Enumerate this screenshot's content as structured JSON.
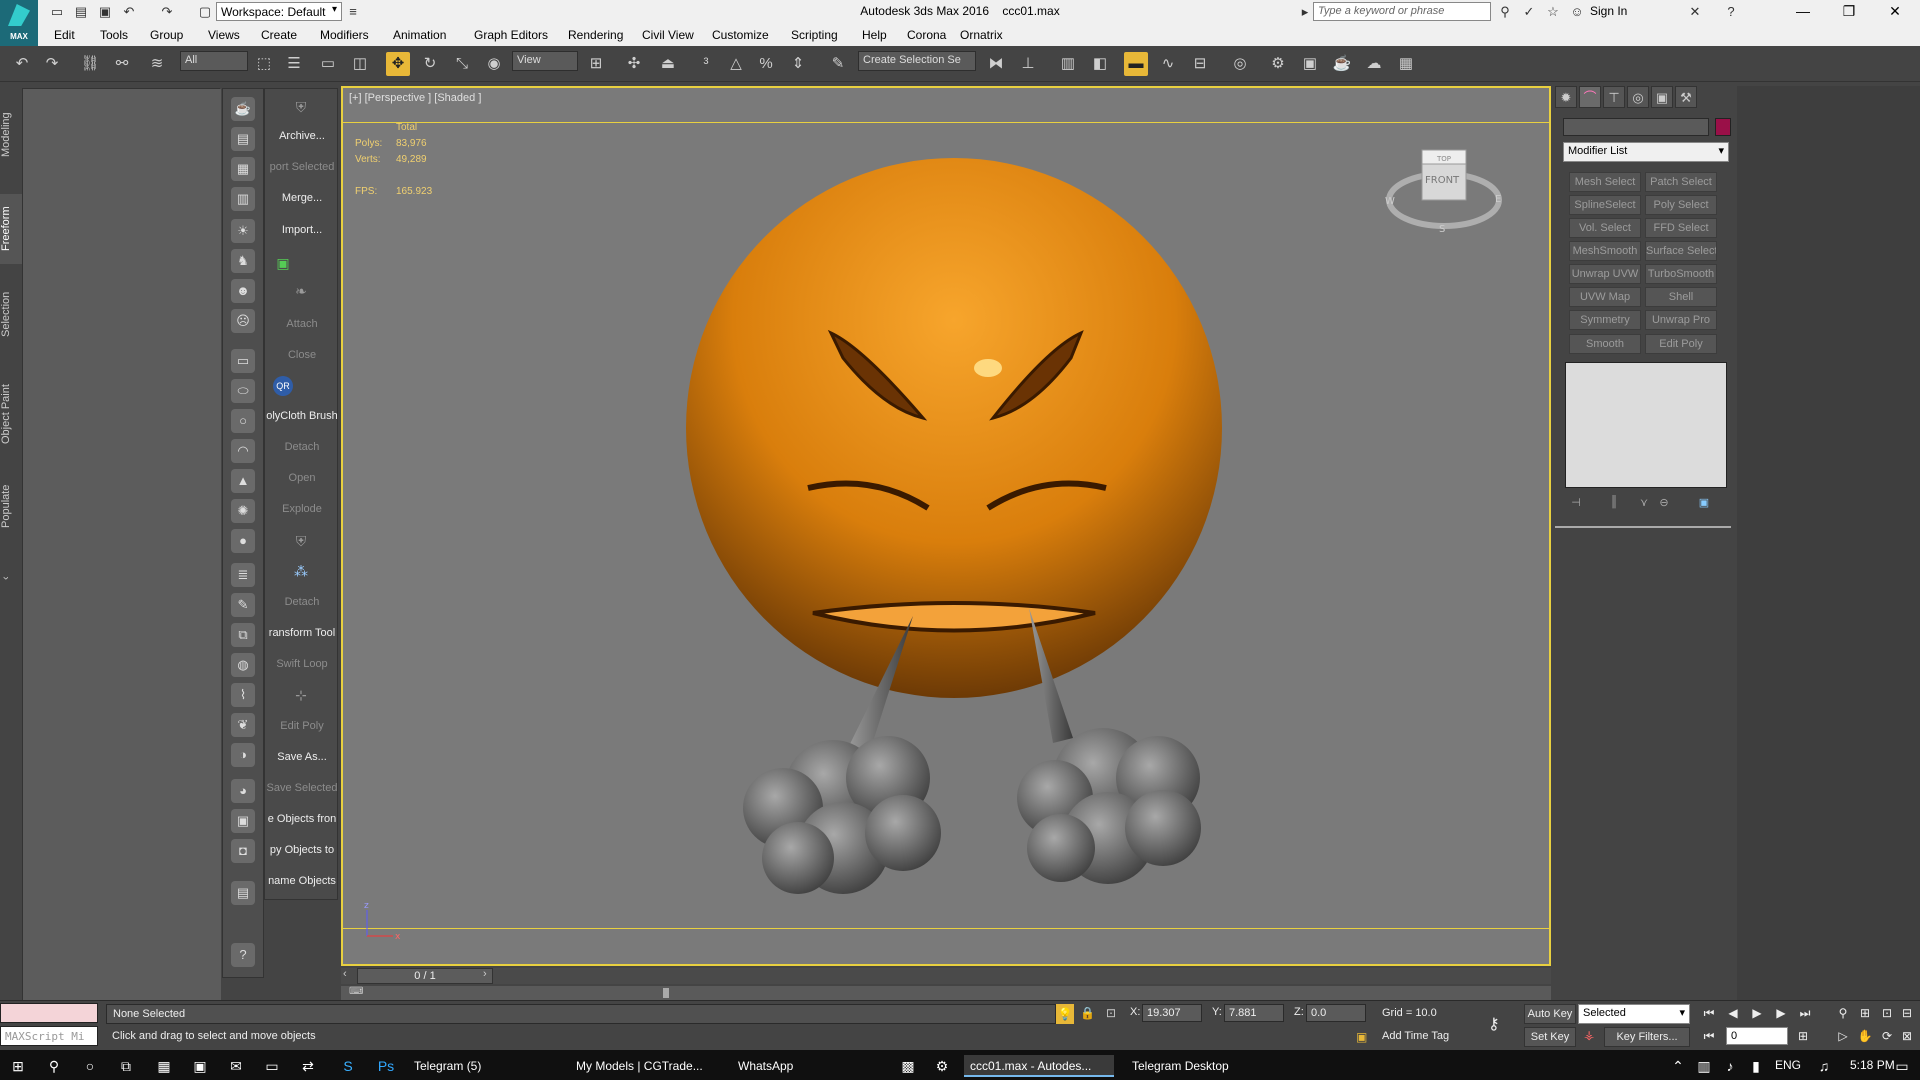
{
  "window": {
    "title": "Autodesk 3ds Max 2016",
    "file": "ccc01.max",
    "logo_text": "MAX"
  },
  "workspace": {
    "label": "Workspace: Default"
  },
  "search": {
    "placeholder": "Type a keyword or phrase"
  },
  "account": {
    "sign_in": "Sign In"
  },
  "menu": [
    "Edit",
    "Tools",
    "Group",
    "Views",
    "Create",
    "Modifiers",
    "Animation",
    "Graph Editors",
    "Rendering",
    "Civil View",
    "Customize",
    "Scripting",
    "Help",
    "Corona",
    "Ornatrix"
  ],
  "toolbar": {
    "filter": "All",
    "ref_coord": "View",
    "named_selection": "Create Selection Se"
  },
  "left_tabs": [
    "Modeling",
    "Freeform",
    "Selection",
    "Object Paint",
    "Populate"
  ],
  "tool_list": [
    {
      "label": "Archive...",
      "enabled": true
    },
    {
      "label": "port Selected",
      "enabled": false
    },
    {
      "label": "Merge...",
      "enabled": true
    },
    {
      "label": "Import...",
      "enabled": true
    },
    {
      "label": "Attach",
      "enabled": false
    },
    {
      "label": "Close",
      "enabled": false
    },
    {
      "label": "QR",
      "enabled": true
    },
    {
      "label": "olyCloth Brush",
      "enabled": true
    },
    {
      "label": "Detach",
      "enabled": false
    },
    {
      "label": "Open",
      "enabled": false
    },
    {
      "label": "Explode",
      "enabled": false
    },
    {
      "label": "Detach",
      "enabled": false
    },
    {
      "label": "ransform Tool",
      "enabled": true
    },
    {
      "label": "Swift Loop",
      "enabled": false
    },
    {
      "label": "Edit Poly",
      "enabled": false
    },
    {
      "label": "Save As...",
      "enabled": true
    },
    {
      "label": "Save Selected",
      "enabled": false
    },
    {
      "label": "e Objects fron",
      "enabled": true
    },
    {
      "label": "py Objects to",
      "enabled": true
    },
    {
      "label": "name Objects",
      "enabled": true
    }
  ],
  "viewport": {
    "label": "[+] [Perspective ] [Shaded ]",
    "stats": {
      "total_label": "Total",
      "polys_label": "Polys:",
      "polys": "83,976",
      "verts_label": "Verts:",
      "verts": "49,289",
      "fps_label": "FPS:",
      "fps": "165.923"
    },
    "viewcube": {
      "top": "TOP",
      "front": "FRONT",
      "w": "W",
      "e": "E",
      "s": "S"
    },
    "colors": {
      "emoji_face": "#e08a10",
      "smoke": "#8a8a8a",
      "background": "#7a7a7a",
      "active_border": "#e8d040"
    }
  },
  "time_slider": {
    "value": "0 / 1"
  },
  "command_panel": {
    "modifier_list": "Modifier List",
    "modifiers": [
      "Mesh Select",
      "Patch Select",
      "SplineSelect",
      "Poly Select",
      "Vol. Select",
      "FFD Select",
      "MeshSmooth",
      "Surface Select",
      "Unwrap UVW",
      "TurboSmooth",
      "UVW Map",
      "Shell",
      "Symmetry",
      "Unwrap Pro",
      "Smooth",
      "Edit Poly"
    ],
    "object_color": "#9a1048"
  },
  "status": {
    "maxscript": "MAXScript Mi",
    "selection": "None Selected",
    "prompt": "Click and drag to select and move objects",
    "x_label": "X:",
    "x": "19.307",
    "y_label": "Y:",
    "y": "7.881",
    "z_label": "Z:",
    "z": "0.0",
    "grid": "Grid = 10.0",
    "add_time_tag": "Add Time Tag",
    "auto_key": "Auto Key",
    "set_key": "Set Key",
    "key_mode": "Selected",
    "key_filters": "Key Filters...",
    "frame": "0"
  },
  "taskbar": {
    "items": [
      "Telegram (5)",
      "My Models | CGTrade...",
      "WhatsApp",
      "ccc01.max - Autodes...",
      "Telegram Desktop"
    ],
    "lang": "ENG",
    "time": "5:18 PM"
  }
}
